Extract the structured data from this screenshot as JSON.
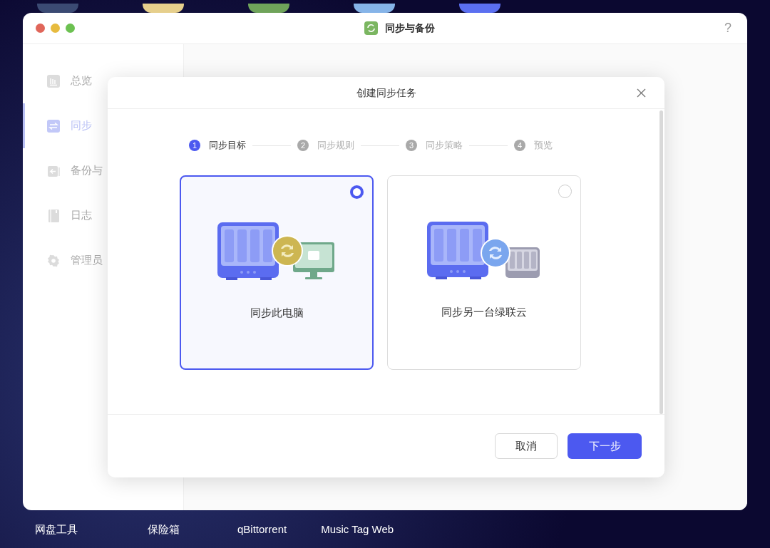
{
  "window": {
    "title": "同步与备份",
    "help": "?"
  },
  "sidebar": {
    "items": [
      {
        "label": "总览",
        "selected": false
      },
      {
        "label": "同步",
        "selected": true
      },
      {
        "label": "备份与",
        "selected": false
      },
      {
        "label": "日志",
        "selected": false
      },
      {
        "label": "管理员",
        "selected": false
      }
    ]
  },
  "dialog": {
    "title": "创建同步任务",
    "steps": [
      {
        "number": "1",
        "label": "同步目标",
        "active": true
      },
      {
        "number": "2",
        "label": "同步规则",
        "active": false
      },
      {
        "number": "3",
        "label": "同步策略",
        "active": false
      },
      {
        "number": "4",
        "label": "预览",
        "active": false
      }
    ],
    "options": [
      {
        "kind": "computer",
        "label": "同步此电脑",
        "selected": true
      },
      {
        "kind": "nas",
        "label": "同步另一台绿联云",
        "selected": false
      }
    ],
    "buttons": {
      "cancel": "取消",
      "next": "下一步"
    }
  },
  "desktop": {
    "apps": [
      "网盘工具",
      "保险箱",
      "qBittorrent",
      "Music Tag Web"
    ]
  }
}
